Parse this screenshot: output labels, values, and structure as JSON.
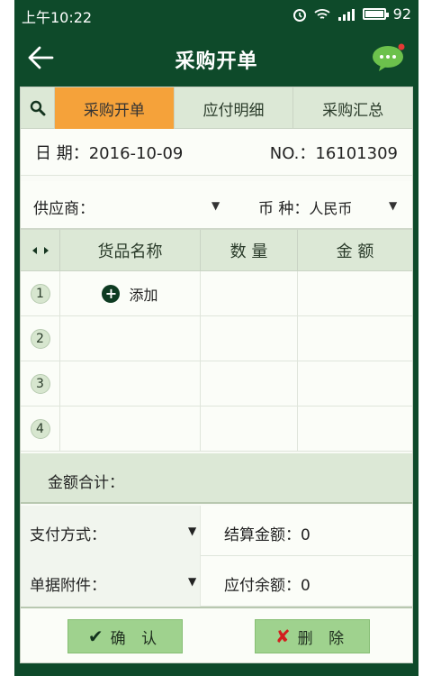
{
  "status_bar": {
    "time": "上午10:22",
    "battery": "92"
  },
  "app_bar": {
    "title": "采购开单"
  },
  "tabs": [
    {
      "label": "采购开单",
      "active": true
    },
    {
      "label": "应付明细",
      "active": false
    },
    {
      "label": "采购汇总",
      "active": false
    }
  ],
  "order": {
    "date_label": "日 期：",
    "date_value": "2016-10-09",
    "no_label": "NO.：",
    "no_value": "16101309",
    "supplier_label": "供应商：",
    "currency_label": "币 种：",
    "currency_value": "人民币"
  },
  "table": {
    "headers": {
      "name": "货品名称",
      "qty": "数 量",
      "amount": "金 额"
    },
    "rows": [
      {
        "index": "1",
        "name": "",
        "qty": "",
        "amount": ""
      },
      {
        "index": "2",
        "name": "",
        "qty": "",
        "amount": ""
      },
      {
        "index": "3",
        "name": "",
        "qty": "",
        "amount": ""
      },
      {
        "index": "4",
        "name": "",
        "qty": "",
        "amount": ""
      }
    ],
    "add_label": "添加"
  },
  "total": {
    "label": "金额合计："
  },
  "payment": {
    "method_label": "支付方式：",
    "settle_label": "结算金额：0",
    "attachment_label": "单据附件：",
    "payable_label": "应付余额：0"
  },
  "buttons": {
    "confirm": "确 认",
    "delete": "删 除"
  },
  "colors": {
    "primary": "#0e4a2a",
    "tab_active": "#f5a23a",
    "button": "#9fd28e",
    "delete_icon": "#d21e1e"
  }
}
